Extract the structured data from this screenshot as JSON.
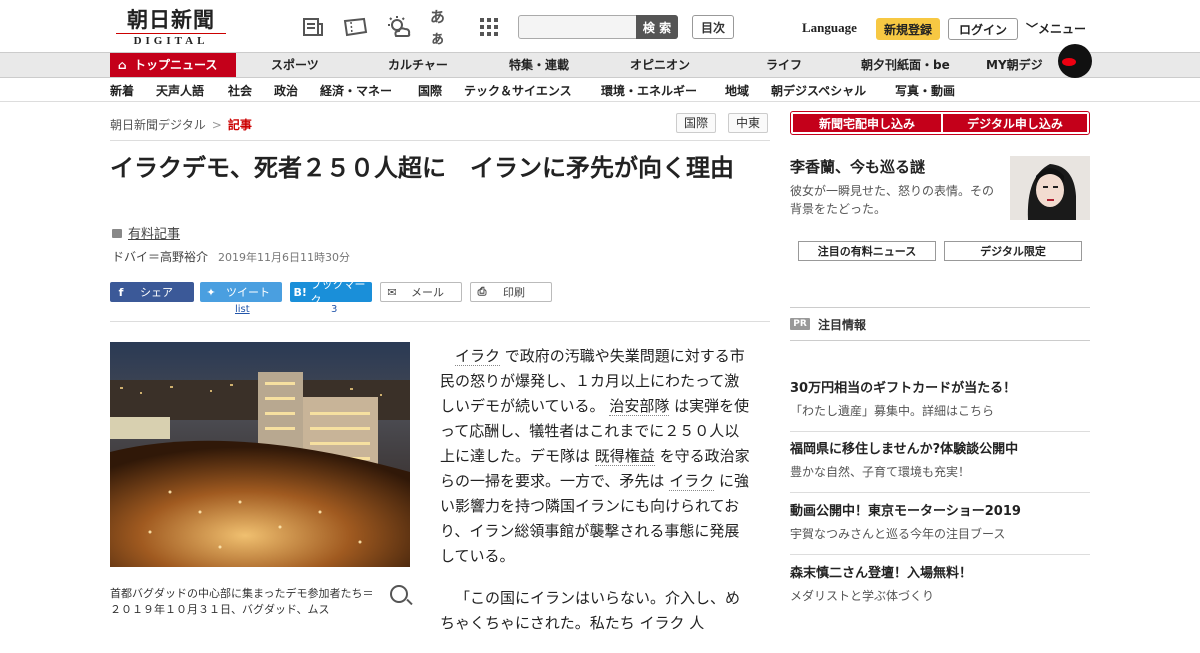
{
  "header": {
    "logo_jp": "朝日新聞",
    "logo_en": "DIGITAL",
    "search_button": "検 索",
    "mokuji": "目次",
    "language": "Language",
    "register": "新規登録",
    "login": "ログイン",
    "menu": "メニュー",
    "icons": [
      "newspaper-icon",
      "ticket-icon",
      "weather-icon",
      "font-size-icon",
      "grid-icon"
    ],
    "font_icon_text": "あぁ"
  },
  "nav_primary": [
    "トップニュース",
    "スポーツ",
    "カルチャー",
    "特集・連載",
    "オピニオン",
    "ライフ",
    "朝夕刊紙面・be",
    "MY朝デジ"
  ],
  "nav_secondary": [
    "新着",
    "天声人語",
    "社会",
    "政治",
    "経済・マネー",
    "国際",
    "テック＆サイエンス",
    "環境・エネルギー",
    "地域",
    "朝デジスペシャル",
    "写真・動画"
  ],
  "breadcrumb": {
    "home": "朝日新聞デジタル",
    "separator": ">",
    "current": "記事"
  },
  "tags": [
    "国際",
    "中東"
  ],
  "article": {
    "title": "イラクデモ、死者２５０人超に　イランに矛先が向く理由",
    "paid_label": "有料記事",
    "byline": "ドバイ＝高野裕介",
    "date": "2019年11月6日11時30分",
    "share": {
      "facebook": "シェア",
      "twitter": "ツイート",
      "hatena": "ブックマーク",
      "hatena_icon": "B!",
      "mail": "メール",
      "print": "印刷",
      "twitter_count": "list",
      "hatena_count": "3"
    },
    "caption": "首都バグダッドの中心部に集まったデモ参加者たち＝２０１９年１０月３１日、バグダッド、ムス",
    "paragraph1": {
      "l1": "イラク",
      "t1": "で政府の汚職や失業問題に対する市民の怒りが爆発し、１カ月以上にわたって激しいデモが続いている。",
      "l2": "治安部隊",
      "t2": "は実弾を使って応酬し、犠牲者はこれまでに２５０人以上に達した。デモ隊は",
      "l3": "既得権益",
      "t3": "を守る政治家らの一掃を要求。一方で、矛先は",
      "l4": "イラク",
      "t4": "に強い影響力を持つ隣国イランにも向けられており、イラン総領事館が襲撃される事態に発展している。"
    },
    "paragraph2": "「この国にイランはいらない。介入し、めちゃくちゃにされた。私たち イラク 人"
  },
  "sidebar": {
    "cta_delivery": "新聞宅配申し込み",
    "cta_digital": "デジタル申し込み",
    "feature_title": "李香蘭、今も巡る謎",
    "feature_text": "彼女が一瞬見せた、怒りの表情。その背景をたどった。",
    "btn_paid_news": "注目の有料ニュース",
    "btn_digital_only": "デジタル限定",
    "pr_badge": "PR",
    "pr_label": "注目情報",
    "pr_items": [
      {
        "title": "30万円相当のギフトカードが当たる！",
        "sub": "「わたし遺産」募集中。詳細はこちら"
      },
      {
        "title": "福岡県に移住しませんか?体験談公開中",
        "sub": "豊かな自然、子育て環境も充実！"
      },
      {
        "title": "動画公開中！東京モーターショー2019",
        "sub": "宇賀なつみさんと巡る今年の注目ブース"
      },
      {
        "title": "森末慎二さん登壇！入場無料！",
        "sub": "メダリストと学ぶ体づくり"
      }
    ]
  },
  "colors": {
    "brand_red": "#c4001a",
    "register_yellow": "#f7c843",
    "facebook": "#3b5998",
    "twitter": "#4a9fe0",
    "hatena": "#1a8fd9"
  }
}
